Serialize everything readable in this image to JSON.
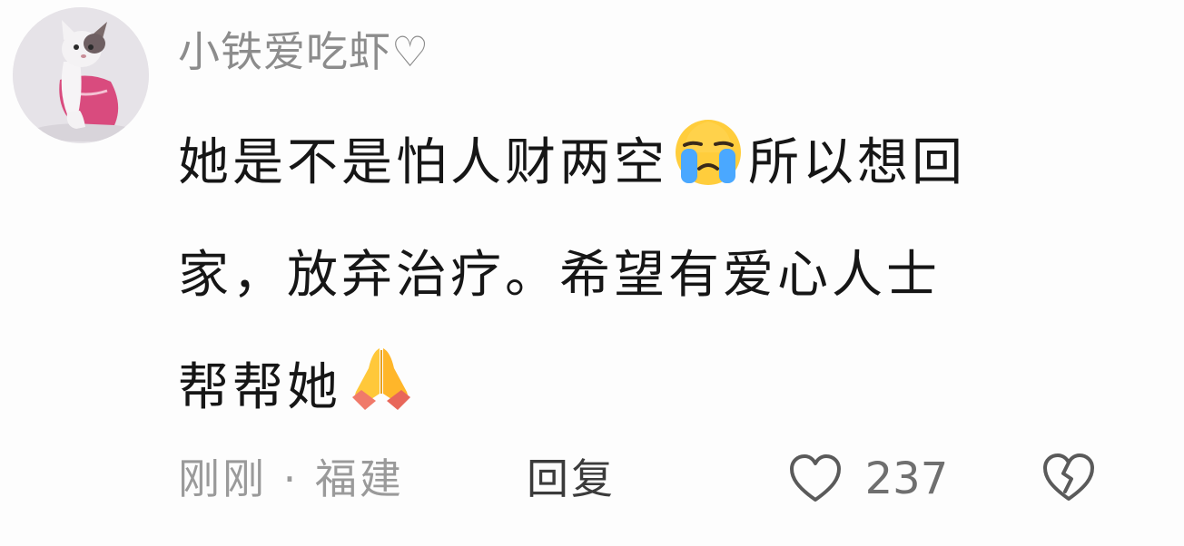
{
  "comment": {
    "username": "小铁爱吃虾♡",
    "text_line_1a": "她是不是怕人财两空",
    "emoji_1": "loudly-crying-face",
    "text_line_1b": "所以想回",
    "text_line_2": "家，放弃治疗。希望有爱心人士",
    "text_line_3": "帮帮她",
    "emoji_2": "folded-hands",
    "time": "刚刚",
    "separator": "·",
    "location": "福建",
    "reply_label": "回复",
    "like_count": "237",
    "like_icon": "heart-outline-icon",
    "dislike_icon": "broken-heart-icon"
  },
  "colors": {
    "username": "#8c8c8c",
    "body_text": "#161616",
    "meta_text": "#9a9a9a",
    "reply_text": "#3b3b3b",
    "emoji_yellow": "#ffcd3c",
    "emoji_blue": "#4aa8ff"
  }
}
